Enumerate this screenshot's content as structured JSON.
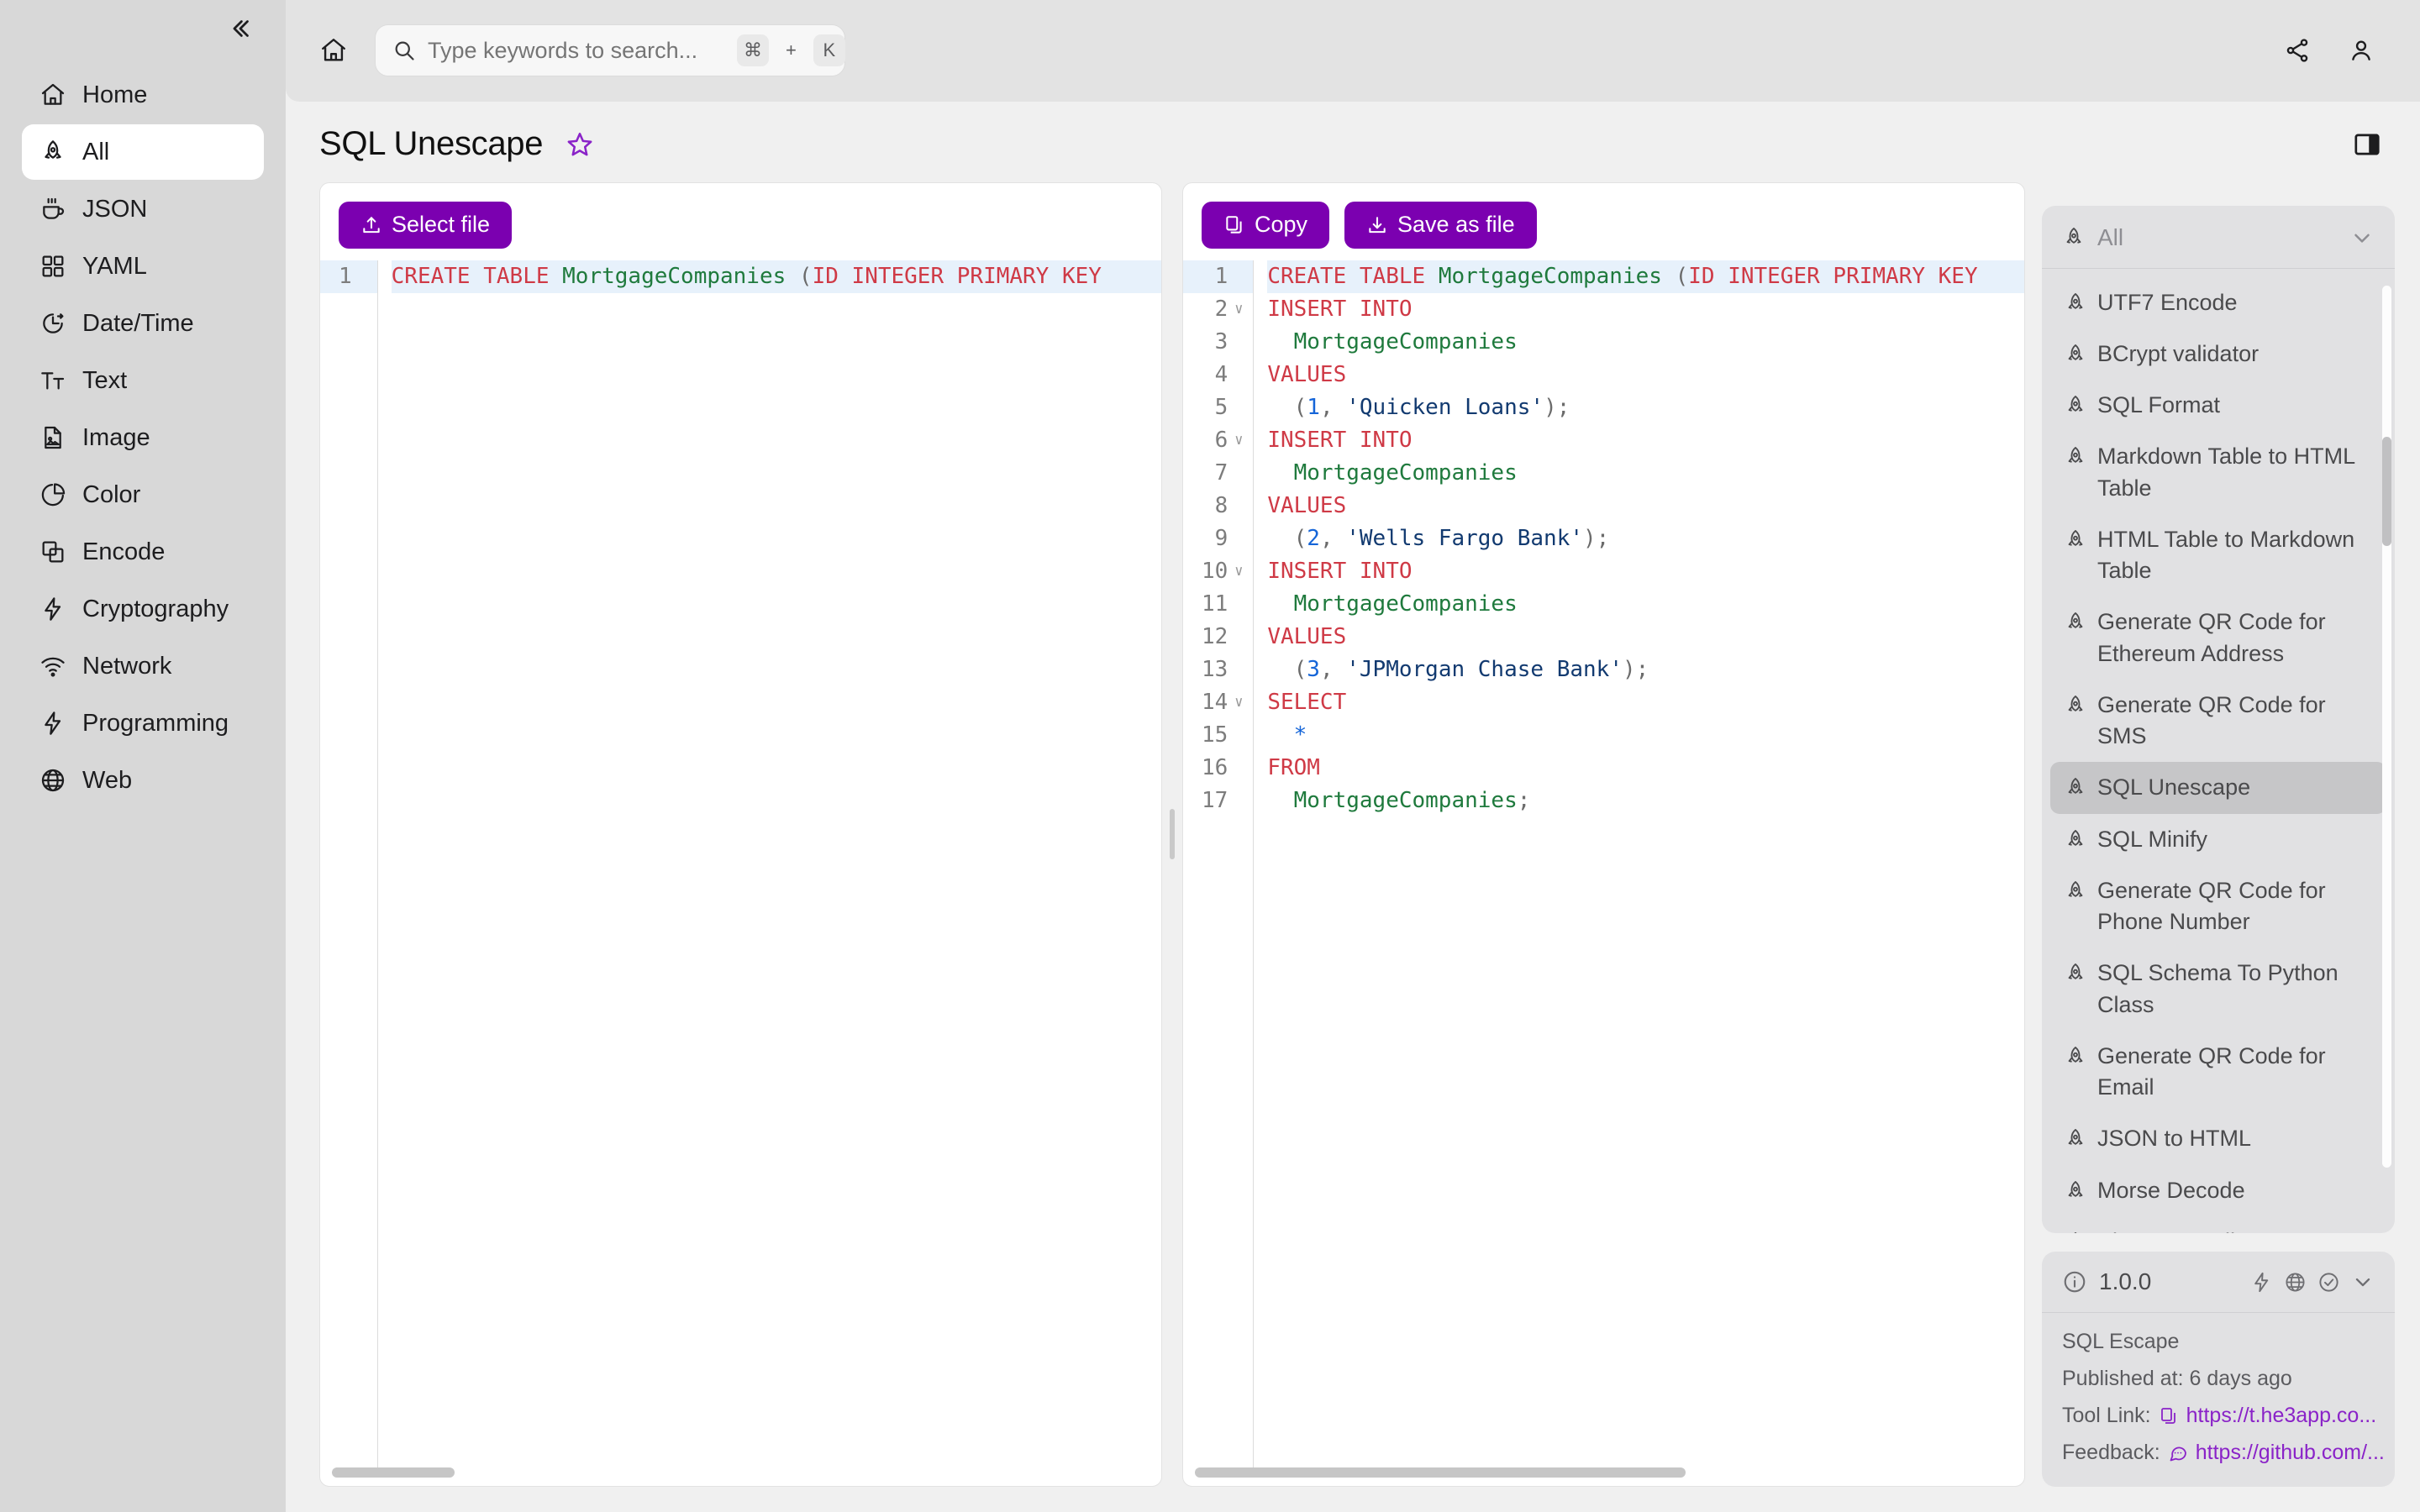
{
  "sidebar": {
    "collapse_icon": "chevron-double-left-icon",
    "items": [
      {
        "label": "Home",
        "icon": "home-icon",
        "active": false
      },
      {
        "label": "All",
        "icon": "rocket-icon",
        "active": true
      },
      {
        "label": "JSON",
        "icon": "coffee-cup-icon",
        "active": false
      },
      {
        "label": "YAML",
        "icon": "grid-icon",
        "active": false
      },
      {
        "label": "Date/Time",
        "icon": "clock-icon",
        "active": false
      },
      {
        "label": "Text",
        "icon": "text-size-icon",
        "active": false
      },
      {
        "label": "Image",
        "icon": "image-file-icon",
        "active": false
      },
      {
        "label": "Color",
        "icon": "pie-chart-icon",
        "active": false
      },
      {
        "label": "Encode",
        "icon": "layers-icon",
        "active": false
      },
      {
        "label": "Cryptography",
        "icon": "lightning-icon",
        "active": false
      },
      {
        "label": "Network",
        "icon": "wifi-icon",
        "active": false
      },
      {
        "label": "Programming",
        "icon": "lightning-icon",
        "active": false
      },
      {
        "label": "Web",
        "icon": "globe-icon",
        "active": false
      }
    ]
  },
  "topbar": {
    "home_icon": "home-icon",
    "search": {
      "icon": "search-icon",
      "placeholder": "Type keywords to search...",
      "value": "",
      "shortcut_key": "⌘",
      "shortcut_plus": "+",
      "shortcut_letter": "K"
    },
    "share_icon": "share-icon",
    "account_icon": "user-icon"
  },
  "page": {
    "title": "SQL Unescape",
    "star_icon": "star-outline-icon",
    "panel_toggle_icon": "right-panel-icon"
  },
  "input_pane": {
    "select_file_label": "Select file",
    "select_file_icon": "upload-icon",
    "lines": [
      {
        "n": "1",
        "fold": false,
        "highlight": true,
        "tokens": [
          {
            "t": "CREATE TABLE ",
            "c": "k"
          },
          {
            "t": "MortgageCompanies ",
            "c": "id"
          },
          {
            "t": "(",
            "c": "p"
          },
          {
            "t": "ID INTEGER PRIMARY KEY",
            "c": "k"
          }
        ]
      }
    ]
  },
  "output_pane": {
    "copy_label": "Copy",
    "copy_icon": "copy-icon",
    "save_label": "Save as file",
    "save_icon": "download-icon",
    "lines": [
      {
        "n": "1",
        "fold": false,
        "highlight": true,
        "tokens": [
          {
            "t": "CREATE TABLE ",
            "c": "k"
          },
          {
            "t": "MortgageCompanies ",
            "c": "id"
          },
          {
            "t": "(",
            "c": "p"
          },
          {
            "t": "ID INTEGER PRIMARY KEY",
            "c": "k"
          }
        ]
      },
      {
        "n": "2",
        "fold": true,
        "highlight": false,
        "tokens": [
          {
            "t": "INSERT INTO",
            "c": "k"
          }
        ]
      },
      {
        "n": "3",
        "fold": false,
        "highlight": false,
        "tokens": [
          {
            "t": "  ",
            "c": "p"
          },
          {
            "t": "MortgageCompanies",
            "c": "id"
          }
        ]
      },
      {
        "n": "4",
        "fold": false,
        "highlight": false,
        "tokens": [
          {
            "t": "VALUES",
            "c": "k"
          }
        ]
      },
      {
        "n": "5",
        "fold": false,
        "highlight": false,
        "tokens": [
          {
            "t": "  (",
            "c": "p"
          },
          {
            "t": "1",
            "c": "num"
          },
          {
            "t": ", ",
            "c": "p"
          },
          {
            "t": "'Quicken Loans'",
            "c": "str"
          },
          {
            "t": ");",
            "c": "p"
          }
        ]
      },
      {
        "n": "6",
        "fold": true,
        "highlight": false,
        "tokens": [
          {
            "t": "INSERT INTO",
            "c": "k"
          }
        ]
      },
      {
        "n": "7",
        "fold": false,
        "highlight": false,
        "tokens": [
          {
            "t": "  ",
            "c": "p"
          },
          {
            "t": "MortgageCompanies",
            "c": "id"
          }
        ]
      },
      {
        "n": "8",
        "fold": false,
        "highlight": false,
        "tokens": [
          {
            "t": "VALUES",
            "c": "k"
          }
        ]
      },
      {
        "n": "9",
        "fold": false,
        "highlight": false,
        "tokens": [
          {
            "t": "  (",
            "c": "p"
          },
          {
            "t": "2",
            "c": "num"
          },
          {
            "t": ", ",
            "c": "p"
          },
          {
            "t": "'Wells Fargo Bank'",
            "c": "str"
          },
          {
            "t": ");",
            "c": "p"
          }
        ]
      },
      {
        "n": "10",
        "fold": true,
        "highlight": false,
        "tokens": [
          {
            "t": "INSERT INTO",
            "c": "k"
          }
        ]
      },
      {
        "n": "11",
        "fold": false,
        "highlight": false,
        "tokens": [
          {
            "t": "  ",
            "c": "p"
          },
          {
            "t": "MortgageCompanies",
            "c": "id"
          }
        ]
      },
      {
        "n": "12",
        "fold": false,
        "highlight": false,
        "tokens": [
          {
            "t": "VALUES",
            "c": "k"
          }
        ]
      },
      {
        "n": "13",
        "fold": false,
        "highlight": false,
        "tokens": [
          {
            "t": "  (",
            "c": "p"
          },
          {
            "t": "3",
            "c": "num"
          },
          {
            "t": ", ",
            "c": "p"
          },
          {
            "t": "'JPMorgan Chase Bank'",
            "c": "str"
          },
          {
            "t": ");",
            "c": "p"
          }
        ]
      },
      {
        "n": "14",
        "fold": true,
        "highlight": false,
        "tokens": [
          {
            "t": "SELECT",
            "c": "k"
          }
        ]
      },
      {
        "n": "15",
        "fold": false,
        "highlight": false,
        "tokens": [
          {
            "t": "  ",
            "c": "p"
          },
          {
            "t": "*",
            "c": "star-op"
          }
        ]
      },
      {
        "n": "16",
        "fold": false,
        "highlight": false,
        "tokens": [
          {
            "t": "FROM",
            "c": "k"
          }
        ]
      },
      {
        "n": "17",
        "fold": false,
        "highlight": false,
        "tokens": [
          {
            "t": "  ",
            "c": "p"
          },
          {
            "t": "MortgageCompanies",
            "c": "id"
          },
          {
            "t": ";",
            "c": "p"
          }
        ]
      }
    ]
  },
  "tools_panel": {
    "filter_label": "All",
    "filter_icon": "rocket-icon",
    "chevron_icon": "chevron-down-icon",
    "items": [
      {
        "label": "UTF7 Encode",
        "active": false
      },
      {
        "label": "BCrypt validator",
        "active": false
      },
      {
        "label": "SQL Format",
        "active": false
      },
      {
        "label": "Markdown Table to HTML Table",
        "active": false
      },
      {
        "label": "HTML Table to Markdown Table",
        "active": false
      },
      {
        "label": "Generate QR Code for Ethereum Address",
        "active": false
      },
      {
        "label": "Generate QR Code for SMS",
        "active": false
      },
      {
        "label": "SQL Unescape",
        "active": true
      },
      {
        "label": "SQL Minify",
        "active": false
      },
      {
        "label": "Generate QR Code for Phone Number",
        "active": false
      },
      {
        "label": "SQL Schema To Python Class",
        "active": false
      },
      {
        "label": "Generate QR Code for Email",
        "active": false
      },
      {
        "label": "JSON to HTML",
        "active": false
      },
      {
        "label": "Morse Decode",
        "active": false
      },
      {
        "label": "PlantUML Editor",
        "active": false
      }
    ]
  },
  "info_panel": {
    "info_icon": "info-circle-icon",
    "version": "1.0.0",
    "header_icons": [
      "lightning-icon",
      "globe-icon",
      "check-circle-icon",
      "chevron-down-icon"
    ],
    "tool_name": "SQL Escape",
    "published_label": "Published at: 6 days ago",
    "tool_link_label": "Tool Link:",
    "tool_link_value": "https://t.he3app.co...",
    "tool_link_icon": "copy-icon",
    "feedback_label": "Feedback:",
    "feedback_value": "https://github.com/...",
    "feedback_icon": "chat-icon"
  },
  "colors": {
    "accent": "#7b00b0",
    "link": "#8a23c8",
    "keyword": "#cf3a46",
    "identifier": "#1f7a3d",
    "string": "#123a70",
    "number": "#1565d8",
    "sidebar_bg": "#d8d8d8",
    "panel_bg": "#e1e1e3"
  }
}
